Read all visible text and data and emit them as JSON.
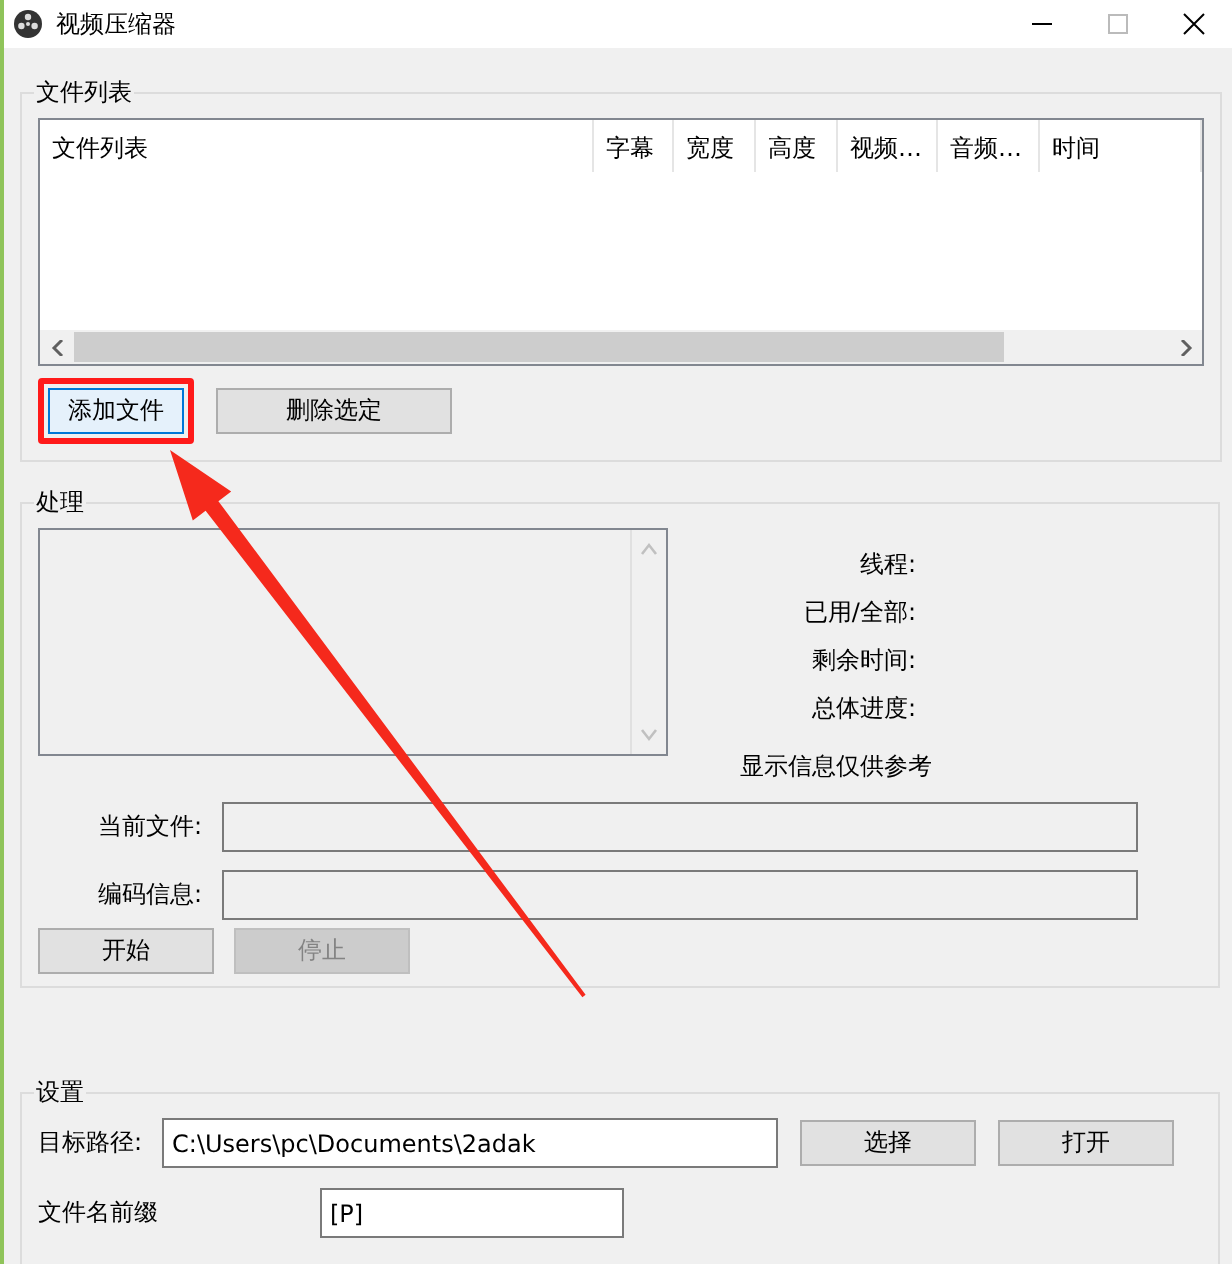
{
  "window": {
    "title": "视频压缩器"
  },
  "file_list": {
    "legend": "文件列表",
    "columns": [
      "文件列表",
      "字幕",
      "宽度",
      "高度",
      "视频…",
      "音频…",
      "时间"
    ],
    "buttons": [
      {
        "label": "添加文件",
        "focused": true,
        "highlighted": true
      },
      {
        "label": "删除选定",
        "focused": false,
        "highlighted": false
      }
    ]
  },
  "processing": {
    "legend": "处理",
    "stats": [
      "线程:",
      "已用/全部:",
      "剩余时间:",
      "总体进度:"
    ],
    "note": "显示信息仅供参考",
    "fields": [
      {
        "label": "当前文件:"
      },
      {
        "label": "编码信息:"
      }
    ],
    "buttons": [
      {
        "label": "开始",
        "disabled": false
      },
      {
        "label": "停止",
        "disabled": true
      }
    ]
  },
  "settings": {
    "legend": "设置",
    "target_path": {
      "label": "目标路径:",
      "value": "C:\\Users\\pc\\Documents\\2adak"
    },
    "buttons": [
      "选择",
      "打开"
    ],
    "prefix": {
      "label": "文件名前缀",
      "value": "[P]"
    }
  }
}
